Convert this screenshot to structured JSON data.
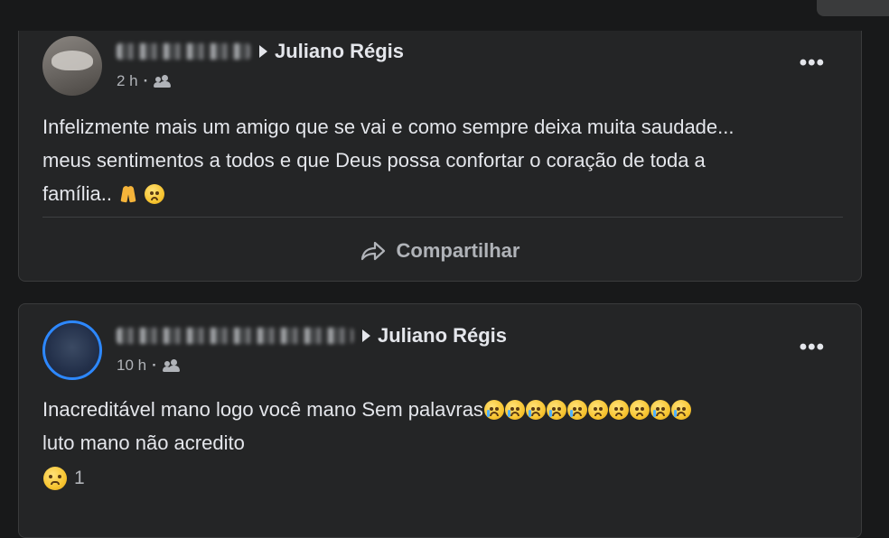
{
  "icons": {
    "friends": "friends-icon",
    "more": "more-icon",
    "share": "share-icon"
  },
  "post1": {
    "author_target": "Juliano Régis",
    "time": "2 h",
    "dot": "·",
    "more": "•••",
    "text_line1": "Infelizmente mais um amigo que se vai e como sempre deixa muita saudade...",
    "text_line2": "meus sentimentos a todos e que  Deus possa confortar o coração de toda a",
    "text_line3": "família..",
    "share_label": "Compartilhar"
  },
  "post2": {
    "author_target": "Juliano Régis",
    "time": "10 h",
    "dot": "·",
    "more": "•••",
    "text_line1": "Inacreditável mano logo você mano  Sem palavras",
    "text_line2": "luto mano não acredito",
    "reaction_count": "1"
  },
  "colors": {
    "background": "#18191a",
    "card": "#242526",
    "text": "#e4e6eb",
    "secondary_text": "#b0b3b8",
    "avatar_ring": "#2d88ff"
  }
}
